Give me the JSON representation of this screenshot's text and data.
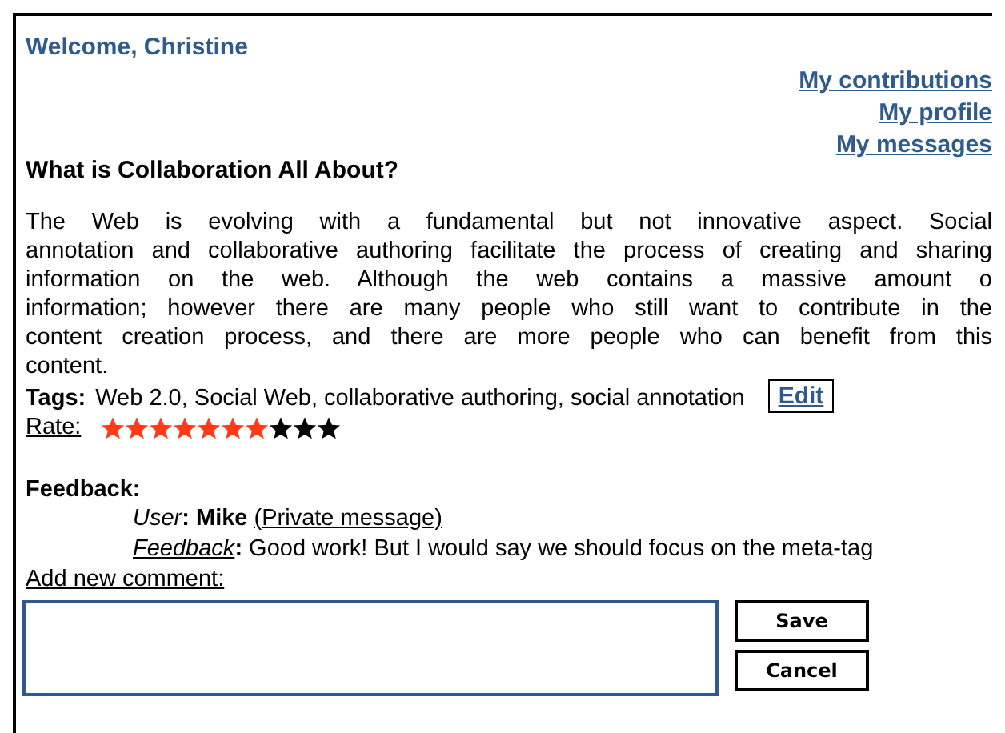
{
  "greeting": "Welcome, Christine",
  "nav_links": [
    "My contributions",
    "My profile",
    "My messages"
  ],
  "heading": "What is Collaboration All About?",
  "paragraph_lines": [
    "The Web is evolving with a fundamental but not innovative aspect. Social",
    "annotation and collaborative authoring facilitate the process of creating and sharing",
    "information on the web. Although the web contains a massive amount o",
    "information; however there are many people who still want to contribute in the",
    "content creation process, and there are more people who can benefit from this",
    "content."
  ],
  "tags": {
    "label": "Tags:",
    "value": "Web 2.0, Social Web, collaborative authoring, social annotation",
    "edit": "Edit"
  },
  "rating": {
    "label": "Rate:",
    "stars": 7
  },
  "feedback": {
    "heading": "Feedback:",
    "user_label": "User",
    "separator": ":",
    "user": "Mike",
    "private_message": "(Private message)",
    "feedback_label": "Feedback",
    "text": "Good work! But I would say we should focus on the meta-tag"
  },
  "add_comment": "Add new comment:",
  "buttons": [
    "Save",
    "Cancel"
  ]
}
